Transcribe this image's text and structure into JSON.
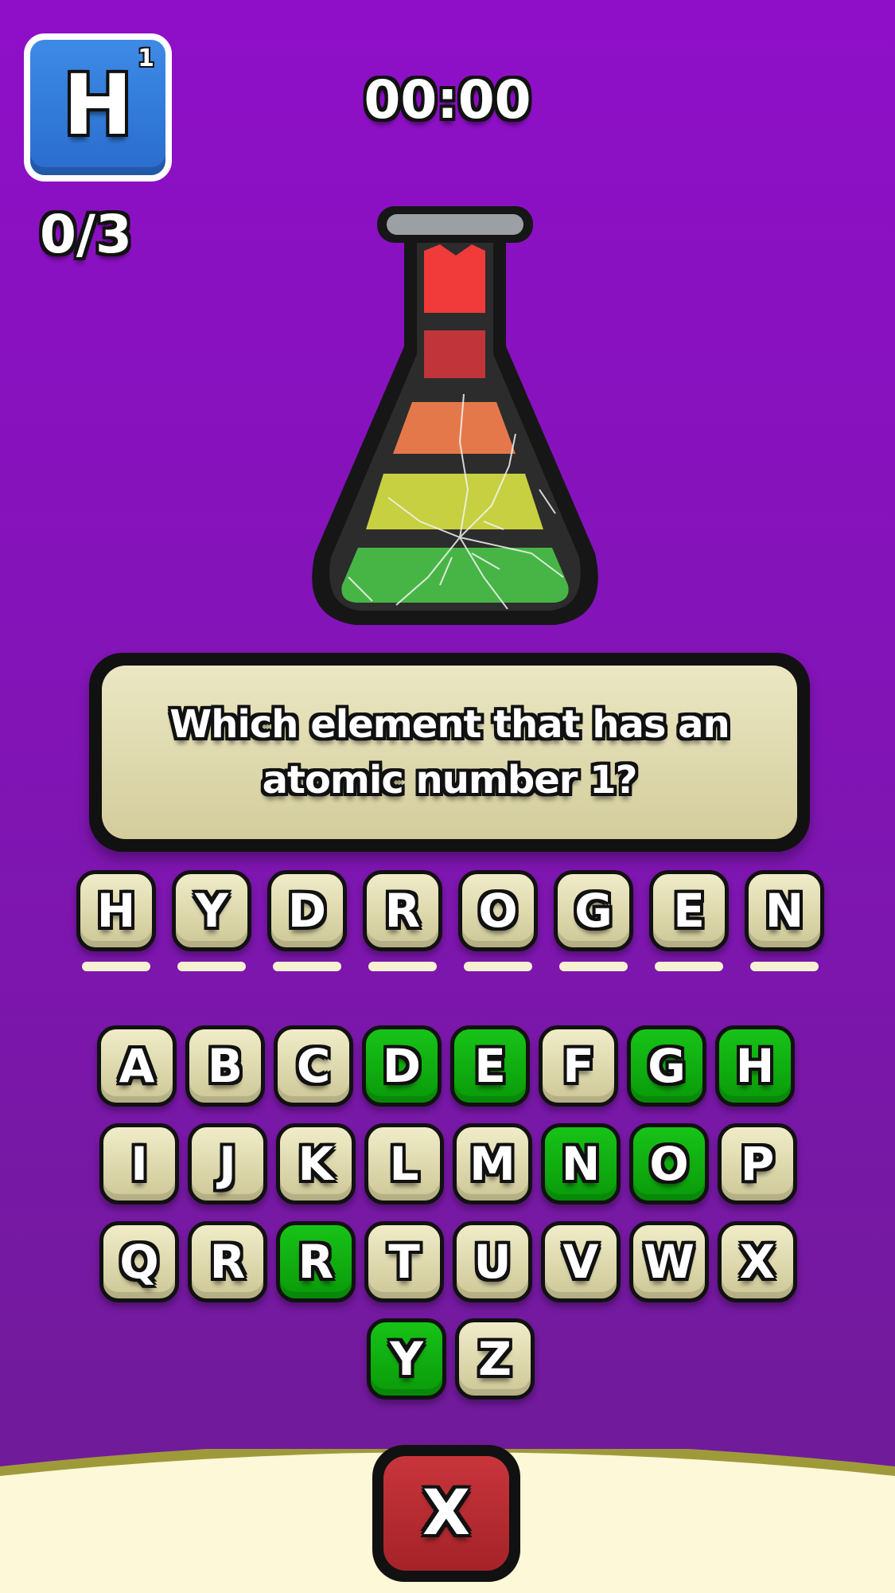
{
  "element": {
    "symbol": "H",
    "atomic_number": "1"
  },
  "score": "0/3",
  "timer": "00:00",
  "question": "Which element that has an atomic number 1?",
  "answer_slots": [
    "H",
    "Y",
    "D",
    "R",
    "O",
    "G",
    "E",
    "N"
  ],
  "keyboard": {
    "rows": [
      [
        {
          "key": "A",
          "used": false
        },
        {
          "key": "B",
          "used": false
        },
        {
          "key": "C",
          "used": false
        },
        {
          "key": "D",
          "used": true
        },
        {
          "key": "E",
          "used": true
        },
        {
          "key": "F",
          "used": false
        },
        {
          "key": "G",
          "used": true
        },
        {
          "key": "H",
          "used": true
        }
      ],
      [
        {
          "key": "I",
          "used": false
        },
        {
          "key": "J",
          "used": false
        },
        {
          "key": "K",
          "used": false
        },
        {
          "key": "L",
          "used": false
        },
        {
          "key": "M",
          "used": false
        },
        {
          "key": "N",
          "used": true
        },
        {
          "key": "O",
          "used": true
        },
        {
          "key": "P",
          "used": false
        }
      ],
      [
        {
          "key": "Q",
          "used": false
        },
        {
          "key": "R",
          "used": false
        },
        {
          "key": "R",
          "used": true
        },
        {
          "key": "T",
          "used": false
        },
        {
          "key": "U",
          "used": false
        },
        {
          "key": "V",
          "used": false
        },
        {
          "key": "W",
          "used": false
        },
        {
          "key": "X",
          "used": false
        }
      ],
      [
        {
          "key": "Y",
          "used": true
        },
        {
          "key": "Z",
          "used": false
        }
      ]
    ]
  },
  "close_label": "X",
  "flask": {
    "layers": [
      "#f13a3a",
      "#c0343a",
      "#e4784a",
      "#c6d040",
      "#47b545"
    ],
    "cracked": true
  },
  "colors": {
    "background_top": "#8f0fc8",
    "background_bottom": "#6d1c95",
    "tile_used": "#12b012",
    "tile_default": "#e2ddb5",
    "close_button": "#b82c31"
  }
}
